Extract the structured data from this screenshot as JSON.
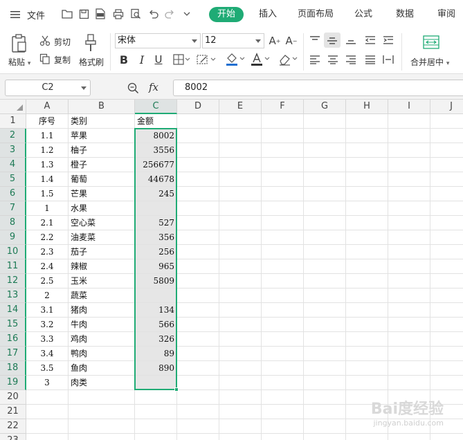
{
  "menubar": {
    "file_label": "文件",
    "tabs": [
      {
        "label": "开始",
        "active": true
      },
      {
        "label": "插入",
        "active": false
      },
      {
        "label": "页面布局",
        "active": false
      },
      {
        "label": "公式",
        "active": false
      },
      {
        "label": "数据",
        "active": false
      },
      {
        "label": "审阅",
        "active": false
      }
    ],
    "accent_color": "#1fab75"
  },
  "ribbon": {
    "paste_label": "粘贴",
    "cut_label": "剪切",
    "copy_label": "复制",
    "format_painter_label": "格式刷",
    "font_name": "宋体",
    "font_size": "12",
    "merge_center_label": "合并居中"
  },
  "formula_bar": {
    "cell_ref": "C2",
    "fx_label": "fx",
    "value": "8002"
  },
  "sheet": {
    "columns": [
      "A",
      "B",
      "C",
      "D",
      "E",
      "F",
      "G",
      "H",
      "I",
      "J"
    ],
    "selected_column": "C",
    "rows": [
      {
        "num": "1",
        "a": "序号",
        "b": "类别",
        "c": "金额"
      },
      {
        "num": "2",
        "a": "1.1",
        "b": "苹果",
        "c": "8002"
      },
      {
        "num": "3",
        "a": "1.2",
        "b": "柚子",
        "c": "3556"
      },
      {
        "num": "4",
        "a": "1.3",
        "b": "橙子",
        "c": "256677"
      },
      {
        "num": "5",
        "a": "1.4",
        "b": "葡萄",
        "c": "44678"
      },
      {
        "num": "6",
        "a": "1.5",
        "b": "芒果",
        "c": "245"
      },
      {
        "num": "7",
        "a": "1",
        "b": "水果",
        "c": ""
      },
      {
        "num": "8",
        "a": "2.1",
        "b": "空心菜",
        "c": "527"
      },
      {
        "num": "9",
        "a": "2.2",
        "b": "油麦菜",
        "c": "356"
      },
      {
        "num": "10",
        "a": "2.3",
        "b": "茄子",
        "c": "256"
      },
      {
        "num": "11",
        "a": "2.4",
        "b": "辣椒",
        "c": "965"
      },
      {
        "num": "12",
        "a": "2.5",
        "b": "玉米",
        "c": "5809"
      },
      {
        "num": "13",
        "a": "2",
        "b": "蔬菜",
        "c": ""
      },
      {
        "num": "14",
        "a": "3.1",
        "b": "猪肉",
        "c": "134"
      },
      {
        "num": "15",
        "a": "3.2",
        "b": "牛肉",
        "c": "566"
      },
      {
        "num": "16",
        "a": "3.3",
        "b": "鸡肉",
        "c": "326"
      },
      {
        "num": "17",
        "a": "3.4",
        "b": "鸭肉",
        "c": "89"
      },
      {
        "num": "18",
        "a": "3.5",
        "b": "鱼肉",
        "c": "890"
      },
      {
        "num": "19",
        "a": "3",
        "b": "肉类",
        "c": ""
      },
      {
        "num": "20",
        "a": "",
        "b": "",
        "c": ""
      },
      {
        "num": "21",
        "a": "",
        "b": "",
        "c": ""
      },
      {
        "num": "22",
        "a": "",
        "b": "",
        "c": ""
      },
      {
        "num": "23",
        "a": "",
        "b": "",
        "c": ""
      }
    ]
  },
  "watermark": {
    "text": "Bai度经验",
    "sub": "jingyan.baidu.com"
  }
}
